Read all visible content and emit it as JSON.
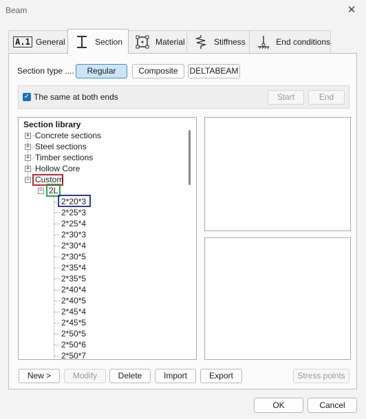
{
  "window": {
    "title": "Beam"
  },
  "tabs": [
    {
      "label": "General",
      "icon": "a1-icon",
      "icon_text": "A.1"
    },
    {
      "label": "Section",
      "icon": "ibeam-icon"
    },
    {
      "label": "Material",
      "icon": "material-icon"
    },
    {
      "label": "Stiffness",
      "icon": "spring-icon"
    },
    {
      "label": "End conditions",
      "icon": "support-icon"
    }
  ],
  "section_type": {
    "label": "Section type ....",
    "options": [
      "Regular",
      "Composite",
      "DELTABEAM"
    ],
    "selected": "Regular"
  },
  "ends": {
    "checkbox_label": "The same at both ends",
    "checked": true,
    "start_label": "Start",
    "end_label": "End"
  },
  "library": {
    "title": "Section library",
    "categories": [
      "Concrete sections",
      "Steel sections",
      "Timber sections",
      "Hollow Core",
      "Custom"
    ],
    "custom_group": "2L",
    "items": [
      "2*20*3",
      "2*25*3",
      "2*25*4",
      "2*30*3",
      "2*30*4",
      "2*30*5",
      "2*35*4",
      "2*35*5",
      "2*40*4",
      "2*40*5",
      "2*45*4",
      "2*45*5",
      "2*50*5",
      "2*50*6",
      "2*50*7"
    ]
  },
  "actions": {
    "new": "New >",
    "modify": "Modify",
    "delete": "Delete",
    "import": "Import",
    "export": "Export",
    "stress_points": "Stress points"
  },
  "dialog": {
    "ok": "OK",
    "cancel": "Cancel"
  },
  "colors": {
    "accent": "#1e6fbf",
    "selected_btn": "#cce4f7",
    "hl_red": "#d0202a",
    "hl_green": "#28a745",
    "hl_blue": "#2b3a9c"
  }
}
